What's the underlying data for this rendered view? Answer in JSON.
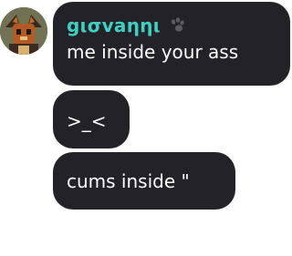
{
  "message_group": {
    "author": {
      "username": "gισvaηηι",
      "avatar_icon": "avatar-icon",
      "badge_icon": "paw-icon",
      "username_color": "#3fd0c1"
    },
    "messages": [
      {
        "text": "me inside your ass"
      },
      {
        "text": ">_<"
      },
      {
        "text": "cums inside \""
      }
    ],
    "bubble_color": "#232228",
    "text_color": "#ffffff",
    "background_color": "#ffffff"
  }
}
